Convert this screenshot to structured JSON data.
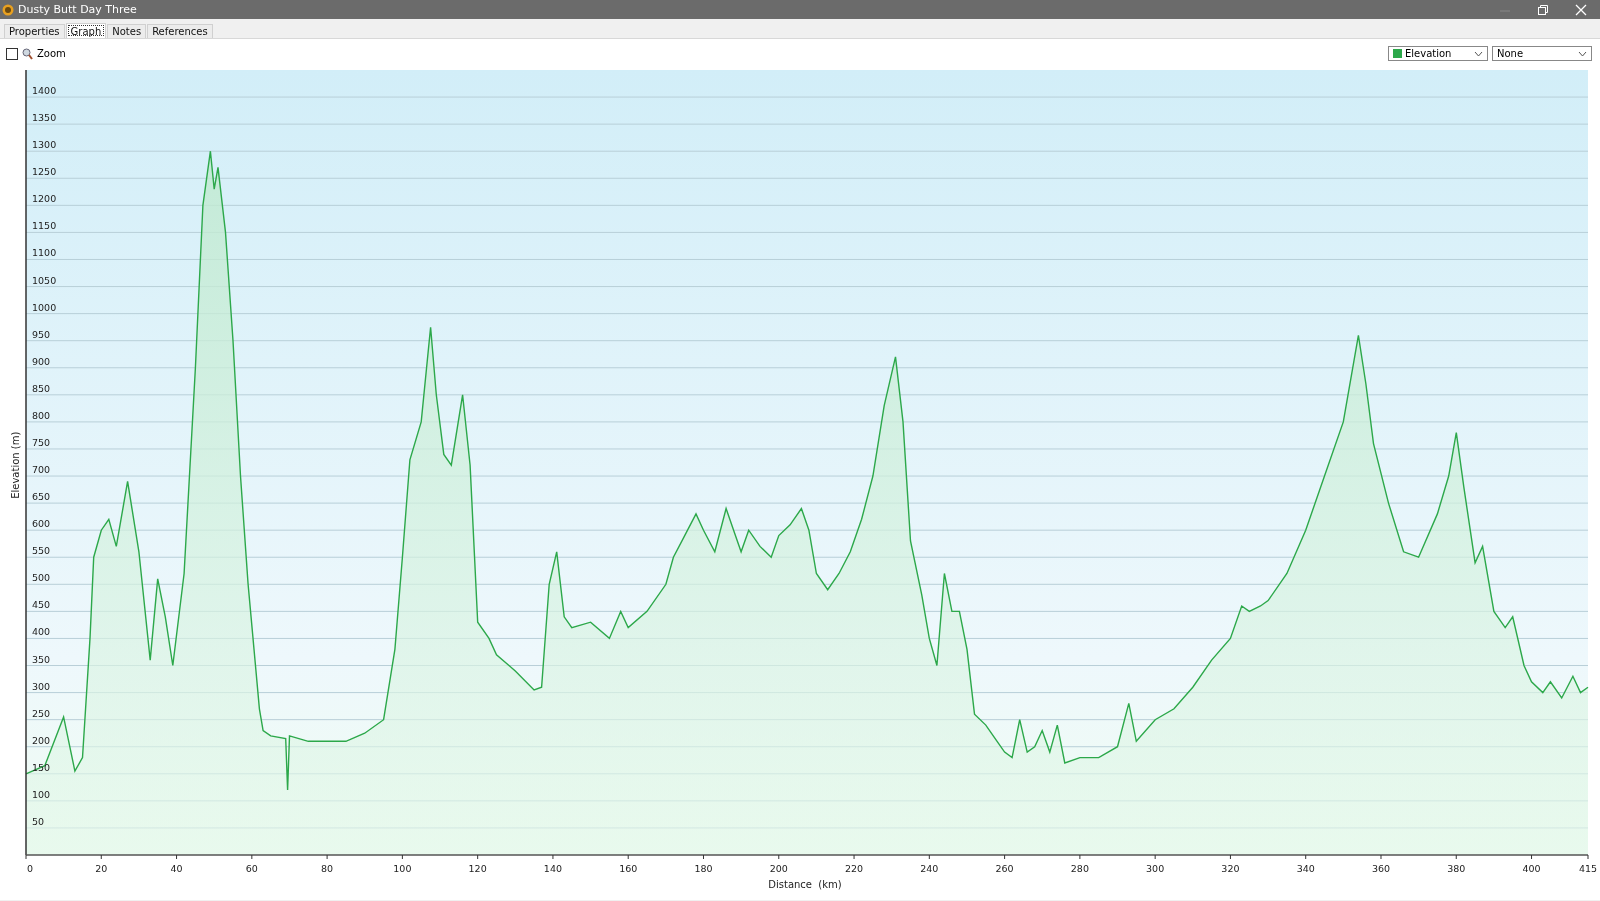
{
  "window": {
    "title": "Dusty Butt Day Three"
  },
  "tabs": [
    {
      "label": "Properties",
      "selected": false
    },
    {
      "label": "Graph",
      "selected": true
    },
    {
      "label": "Notes",
      "selected": false
    },
    {
      "label": "References",
      "selected": false
    }
  ],
  "toolbar": {
    "zoom": {
      "label": "Zoom",
      "checked": false
    },
    "second_select": {
      "value": "None"
    }
  },
  "chart": {
    "chart_data": {
      "type": "area",
      "xlabel": "Distance  (km)",
      "ylabel": "Elevation (m)",
      "xlim": [
        0,
        415
      ],
      "ylim": [
        0,
        1450
      ],
      "grid": true,
      "xticks": [
        0,
        20,
        40,
        60,
        80,
        100,
        120,
        140,
        160,
        180,
        200,
        220,
        240,
        260,
        280,
        300,
        320,
        340,
        360,
        380,
        400,
        415
      ],
      "yticks": [
        50,
        100,
        150,
        200,
        250,
        300,
        350,
        400,
        450,
        500,
        550,
        600,
        650,
        700,
        750,
        800,
        850,
        900,
        950,
        1000,
        1050,
        1100,
        1150,
        1200,
        1250,
        1300,
        1350,
        1400
      ],
      "x": [
        0,
        5,
        10,
        13,
        15,
        17,
        18,
        20,
        22,
        24,
        27,
        30,
        33,
        35,
        37,
        39,
        42,
        45,
        47,
        49,
        50,
        51,
        53,
        55,
        57,
        59,
        62,
        63,
        65,
        69,
        69.5,
        70,
        75,
        80,
        85,
        90,
        95,
        98,
        100,
        102,
        105,
        107.5,
        109,
        111,
        113,
        116,
        118,
        120,
        123,
        125,
        130,
        135,
        137,
        139,
        141,
        143,
        145,
        150,
        155,
        158,
        160,
        165,
        170,
        172,
        175,
        178,
        180,
        183,
        186,
        188,
        190,
        192,
        195,
        198,
        200,
        203,
        206,
        208,
        210,
        213,
        216,
        219,
        222,
        225,
        228,
        231,
        233,
        235,
        238,
        240,
        242,
        244,
        246,
        248,
        250,
        252,
        255,
        258,
        260,
        262,
        264,
        266,
        268,
        270,
        272,
        274,
        276,
        280,
        285,
        290,
        293,
        295,
        300,
        305,
        310,
        315,
        320,
        323,
        325,
        328,
        330,
        335,
        340,
        345,
        350,
        354,
        356,
        358,
        362,
        366,
        370,
        375,
        378,
        380,
        382,
        385,
        387,
        390,
        393,
        395,
        398,
        400,
        403,
        405,
        408,
        411,
        413,
        415
      ],
      "series": [
        {
          "name": "Elevation",
          "color": "#2ca84a",
          "values": [
            150,
            165,
            255,
            155,
            180,
            400,
            550,
            600,
            620,
            570,
            690,
            560,
            360,
            510,
            440,
            350,
            520,
            900,
            1200,
            1300,
            1230,
            1270,
            1150,
            950,
            700,
            500,
            270,
            230,
            220,
            215,
            120,
            220,
            210,
            210,
            210,
            225,
            250,
            380,
            550,
            730,
            800,
            975,
            850,
            740,
            720,
            850,
            720,
            430,
            400,
            370,
            340,
            305,
            310,
            500,
            560,
            440,
            420,
            430,
            400,
            450,
            420,
            450,
            500,
            550,
            590,
            630,
            600,
            560,
            640,
            600,
            560,
            600,
            570,
            550,
            590,
            610,
            640,
            600,
            520,
            490,
            520,
            560,
            620,
            700,
            830,
            920,
            800,
            580,
            480,
            400,
            350,
            520,
            450,
            450,
            380,
            260,
            240,
            210,
            190,
            180,
            250,
            190,
            200,
            230,
            190,
            240,
            170,
            180,
            180,
            200,
            280,
            210,
            250,
            270,
            310,
            360,
            400,
            460,
            450,
            460,
            470,
            520,
            600,
            700,
            800,
            960,
            870,
            760,
            650,
            560,
            550,
            630,
            700,
            780,
            680,
            540,
            570,
            450,
            420,
            440,
            350,
            320,
            300,
            320,
            290,
            330,
            300,
            310
          ]
        }
      ]
    }
  }
}
